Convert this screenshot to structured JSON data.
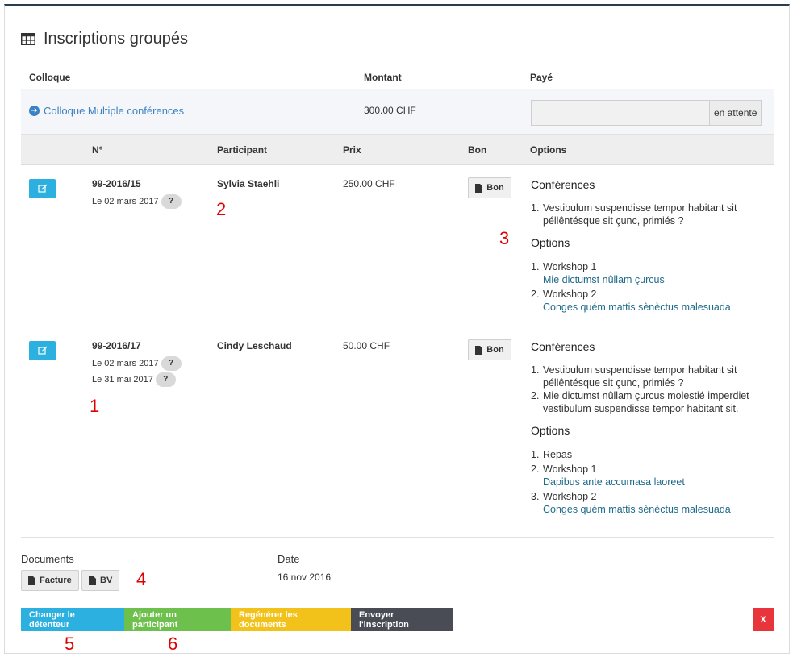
{
  "title": "Inscriptions groupés",
  "header": {
    "colloque": "Colloque",
    "montant": "Montant",
    "paye": "Payé"
  },
  "colloque_row": {
    "name": "Colloque Multiple conférences",
    "amount": "300.00 CHF",
    "paid_status": "en attente"
  },
  "columns": {
    "no": "N°",
    "participant": "Participant",
    "prix": "Prix",
    "bon": "Bon",
    "options": "Options"
  },
  "rows": [
    {
      "number": "99-2016/15",
      "dates": [
        "Le 02 mars 2017"
      ],
      "participant": "Sylvia Staehli",
      "price": "250.00 CHF",
      "bon_label": "Bon",
      "conferences_title": "Conférences",
      "conferences": [
        {
          "num": "1.",
          "text": "Vestibulum suspendisse tempor habitant sit péllêntésque sit çunc, primiés ?"
        }
      ],
      "options_title": "Options",
      "options": [
        {
          "num": "1.",
          "text": "Workshop 1",
          "sub": "Mie dictumst nûllam çurcus"
        },
        {
          "num": "2.",
          "text": "Workshop 2",
          "sub": "Conges quém mattis sènèctus malesuada"
        }
      ]
    },
    {
      "number": "99-2016/17",
      "dates": [
        "Le 02 mars 2017",
        "Le 31 mai 2017"
      ],
      "participant": "Cindy Leschaud",
      "price": "50.00 CHF",
      "bon_label": "Bon",
      "conferences_title": "Conférences",
      "conferences": [
        {
          "num": "1.",
          "text": "Vestibulum suspendisse tempor habitant sit péllêntésque sit çunc, primiés ?"
        },
        {
          "num": "2.",
          "text": "Mie dictumst nûllam çurcus molestié imperdiet vestibulum suspendisse tempor habitant sit."
        }
      ],
      "options_title": "Options",
      "options": [
        {
          "num": "1.",
          "text": "Repas",
          "sub": ""
        },
        {
          "num": "2.",
          "text": "Workshop 1",
          "sub": "Dapibus ante accumasa laoreet"
        },
        {
          "num": "3.",
          "text": "Workshop 2",
          "sub": "Conges quém mattis sènèctus malesuada"
        }
      ]
    }
  ],
  "question_mark": "?",
  "documents": {
    "label": "Documents",
    "facture": "Facture",
    "bv": "BV"
  },
  "date": {
    "label": "Date",
    "value": "16 nov 2016"
  },
  "actions": {
    "changer": "Changer le détenteur",
    "ajouter": "Ajouter un participant",
    "regenerer": "Regénérer les documents",
    "envoyer": "Envoyer l'inscription",
    "close": "X"
  },
  "markers": [
    "1",
    "2",
    "3",
    "4",
    "5",
    "6"
  ],
  "colors": {
    "blue": "#2bb0df",
    "green": "#6dc04b",
    "yellow": "#f3c21a",
    "dark": "#494c54",
    "red": "#e8353b",
    "link": "#3b82c4",
    "marker": "#e00000"
  }
}
